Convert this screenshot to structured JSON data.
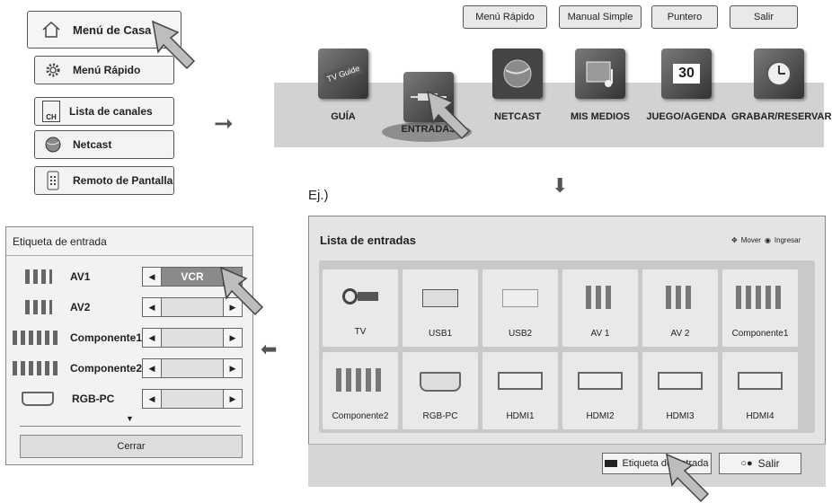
{
  "home_menu": {
    "home_label": "Menú de Casa",
    "items": [
      {
        "label": "Menú Rápido",
        "icon": "gear-icon"
      },
      {
        "label": "Lista de canales",
        "icon": "channel-list-icon",
        "badge": "CH"
      },
      {
        "label": "Netcast",
        "icon": "globe-icon"
      },
      {
        "label": "Remoto de Pantalla",
        "icon": "remote-icon"
      }
    ]
  },
  "top_buttons": [
    "Menú Rápido",
    "Manual Simple",
    "Puntero",
    "Salir"
  ],
  "home_bar": {
    "cards": [
      {
        "label": "GUÍA",
        "icon": "tv-guide-icon",
        "icon_text": "TV Guide"
      },
      {
        "label": "ENTRADAS",
        "icon": "inputs-icon"
      },
      {
        "label": "NETCAST",
        "icon": "globe-icon"
      },
      {
        "label": "MIS MEDIOS",
        "icon": "media-icon"
      },
      {
        "label": "JUEGO/AGENDA",
        "icon": "calendar-icon",
        "icon_text": "30"
      },
      {
        "label": "GRABAR/RESERVAR",
        "icon": "clock-icon"
      }
    ]
  },
  "example_label": "Ej.)",
  "input_list": {
    "title": "Lista de entradas",
    "hint_move": "Mover",
    "hint_enter": "Ingresar",
    "row1": [
      "TV",
      "USB1",
      "USB2",
      "AV 1",
      "AV 2",
      "Componente1"
    ],
    "row2": [
      "Componente2",
      "RGB-PC",
      "HDMI1",
      "HDMI2",
      "HDMI3",
      "HDMI4"
    ],
    "label_button": "Etiqueta de entrada",
    "exit_button": "Salir"
  },
  "input_label_dialog": {
    "title": "Etiqueta de entrada",
    "rows": [
      {
        "name": "AV1",
        "value": "VCR"
      },
      {
        "name": "AV2",
        "value": ""
      },
      {
        "name": "Componente1",
        "value": ""
      },
      {
        "name": "Componente2",
        "value": ""
      },
      {
        "name": "RGB-PC",
        "value": ""
      }
    ],
    "close_button": "Cerrar"
  },
  "colors": {
    "panel": "#e4e4e4",
    "bar": "#d2d2d2",
    "highlight": "#7a7a7a"
  }
}
